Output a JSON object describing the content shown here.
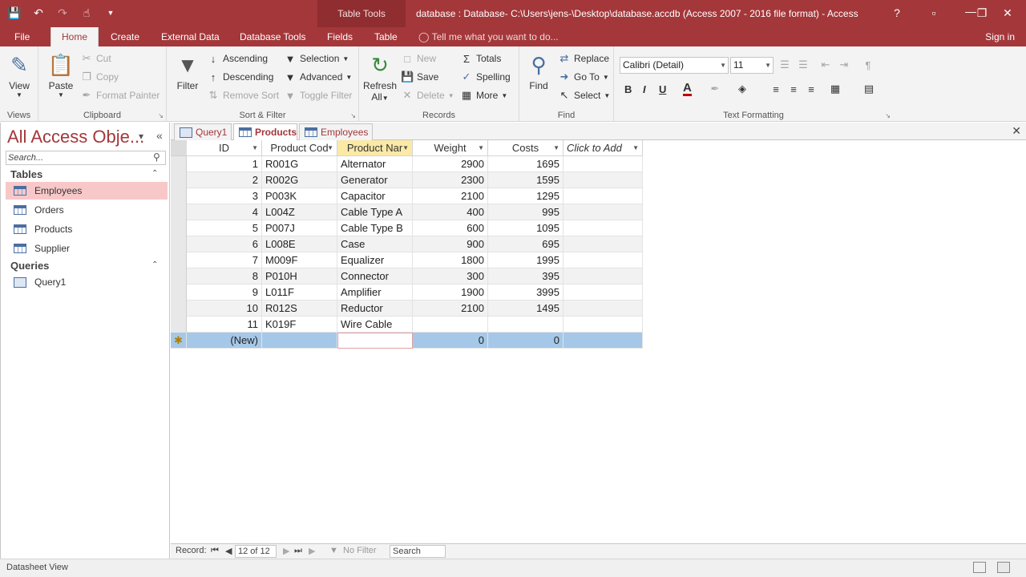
{
  "titlebar": {
    "context_tab": "Table Tools",
    "title": "database : Database- C:\\Users\\jens-\\Desktop\\database.accdb (Access 2007 - 2016 file format) - Access",
    "help": "?"
  },
  "tabs": {
    "file": "File",
    "home": "Home",
    "create": "Create",
    "external": "External Data",
    "dbtools": "Database Tools",
    "fields": "Fields",
    "table": "Table",
    "tellme": "Tell me what you want to do...",
    "signin": "Sign in"
  },
  "ribbon": {
    "views": {
      "label": "Views",
      "view": "View"
    },
    "clipboard": {
      "label": "Clipboard",
      "paste": "Paste",
      "cut": "Cut",
      "copy": "Copy",
      "painter": "Format Painter"
    },
    "sort": {
      "label": "Sort & Filter",
      "filter": "Filter",
      "ascending": "Ascending",
      "descending": "Descending",
      "remove": "Remove Sort",
      "selection": "Selection",
      "advanced": "Advanced",
      "toggle": "Toggle Filter"
    },
    "records": {
      "label": "Records",
      "refresh": "Refresh",
      "refresh2": "All",
      "new": "New",
      "save": "Save",
      "delete": "Delete",
      "totals": "Totals",
      "spelling": "Spelling",
      "more": "More"
    },
    "find": {
      "label": "Find",
      "find": "Find",
      "replace": "Replace",
      "goto": "Go To",
      "select": "Select"
    },
    "text": {
      "label": "Text Formatting",
      "font": "Calibri (Detail)",
      "size": "11",
      "bold": "B",
      "italic": "I",
      "underline": "U",
      "fontcolor": "A"
    }
  },
  "nav": {
    "title": "All Access Obje...",
    "search_placeholder": "Search...",
    "tables_header": "Tables",
    "tables": [
      "Employees",
      "Orders",
      "Products",
      "Supplier"
    ],
    "queries_header": "Queries",
    "queries": [
      "Query1"
    ]
  },
  "doctabs": [
    "Query1",
    "Products",
    "Employees"
  ],
  "sheet": {
    "headers": [
      "ID",
      "Product Cod",
      "Product Nar",
      "Weight",
      "Costs",
      "Click to Add"
    ],
    "rows": [
      [
        "1",
        "R001G",
        "Alternator",
        "2900",
        "1695"
      ],
      [
        "2",
        "R002G",
        "Generator",
        "2300",
        "1595"
      ],
      [
        "3",
        "P003K",
        "Capacitor",
        "2100",
        "1295"
      ],
      [
        "4",
        "L004Z",
        "Cable Type A",
        "400",
        "995"
      ],
      [
        "5",
        "P007J",
        "Cable Type B",
        "600",
        "1095"
      ],
      [
        "6",
        "L008E",
        "Case",
        "900",
        "695"
      ],
      [
        "7",
        "M009F",
        "Equalizer",
        "1800",
        "1995"
      ],
      [
        "8",
        "P010H",
        "Connector",
        "300",
        "395"
      ],
      [
        "9",
        "L011F",
        "Amplifier",
        "1900",
        "3995"
      ],
      [
        "10",
        "R012S",
        "Reductor",
        "2100",
        "1495"
      ],
      [
        "11",
        "K019F",
        "Wire Cable",
        "",
        ""
      ]
    ],
    "newrow": {
      "marker": "✱",
      "id": "(New)",
      "weight": "0",
      "costs": "0"
    }
  },
  "recordnav": {
    "label": "Record:",
    "current": "12 of 12",
    "filter": "No Filter",
    "search": "Search"
  },
  "status": {
    "text": "Datasheet View"
  },
  "colors": {
    "accent": "#a4373a",
    "selected_nav": "#f8c8c9",
    "new_row": "#a6c8e8",
    "active_header": "#fbe9a6"
  }
}
